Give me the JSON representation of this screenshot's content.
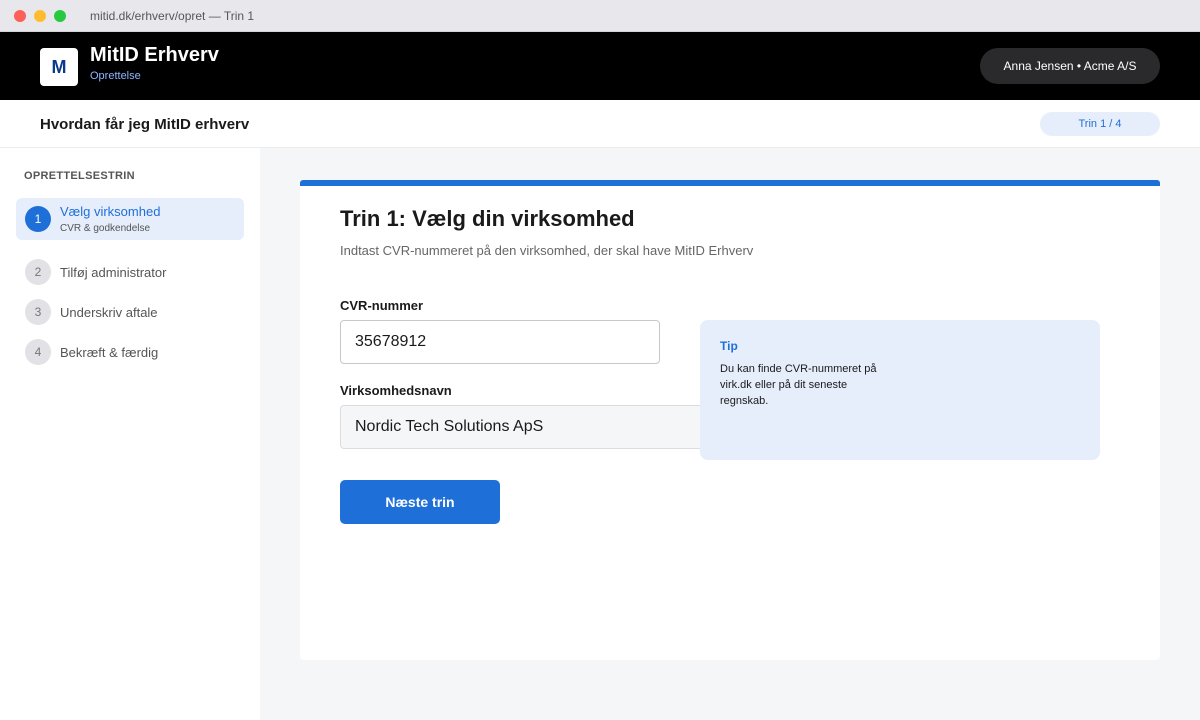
{
  "browser": {
    "title": "mitid.dk/erhverv/opret — Trin 1"
  },
  "header": {
    "logo_letter": "M",
    "brand": "MitID Erhverv",
    "subtitle": "Oprettelse",
    "user": "Anna Jensen • Acme A/S"
  },
  "subheader": {
    "title": "Hvordan får jeg MitID erhverv",
    "step_indicator": "Trin 1 / 4"
  },
  "sidebar": {
    "heading": "OPRETTELSESTRIN",
    "steps": [
      {
        "number": "1",
        "label": "Vælg virksomhed",
        "sublabel": "CVR & godkendelse",
        "active": true
      },
      {
        "number": "2",
        "label": "Tilføj administrator"
      },
      {
        "number": "3",
        "label": "Underskriv aftale"
      },
      {
        "number": "4",
        "label": "Bekræft & færdig"
      }
    ]
  },
  "main": {
    "title": "Trin 1: Vælg din virksomhed",
    "description": "Indtast CVR-nummeret på den virksomhed, der skal have MitID Erhverv",
    "cvr": {
      "label": "CVR-nummer",
      "value": "35678912"
    },
    "company": {
      "label": "Virksomhedsnavn",
      "value": "Nordic Tech Solutions ApS"
    },
    "tip": {
      "title": "Tip",
      "text": "Du kan finde CVR-nummeret på virk.dk eller på dit seneste regnskab."
    },
    "next_button": "Næste trin"
  },
  "colors": {
    "accent": "#1f6fd9",
    "header_bg": "#000000",
    "tip_bg": "#e6eefc"
  }
}
